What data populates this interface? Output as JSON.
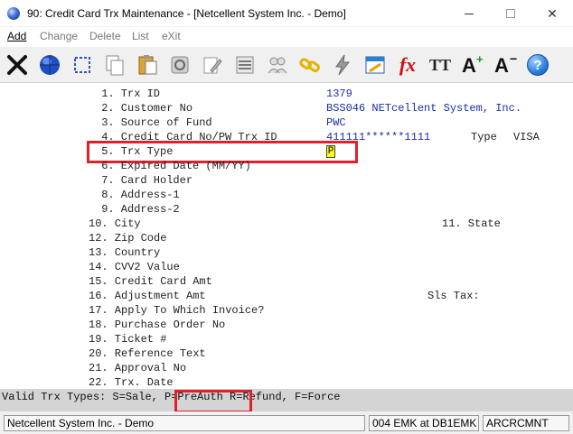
{
  "window": {
    "title": "90: Credit Card Trx Maintenance - [Netcellent System Inc. - Demo]",
    "controls": {
      "minimize": "—",
      "maximize": "☐",
      "close": "✕"
    }
  },
  "menu": [
    {
      "label": "Add",
      "active": true
    },
    {
      "label": "Change",
      "active": false
    },
    {
      "label": "Delete",
      "active": false
    },
    {
      "label": "List",
      "active": false
    },
    {
      "label": "eXit",
      "active": false
    }
  ],
  "toolbar": {
    "icons": [
      "close-x-icon",
      "globe-icon",
      "select-icon",
      "copy-icon",
      "paste-icon",
      "settings-icon",
      "edit-icon",
      "list-icon",
      "users-icon",
      "link-icon",
      "lightning-icon",
      "calendar-icon",
      "function-icon",
      "font-icon",
      "font-increase-icon",
      "font-decrease-icon",
      "help-icon"
    ],
    "fx_text": "fx",
    "tt_text": "TT",
    "a_plus": "A",
    "a_minus": "A",
    "help_text": "?"
  },
  "fields": [
    {
      "label": " 1. Trx ID",
      "value": "1379"
    },
    {
      "label": " 2. Customer No",
      "value": "BSS046 NETcellent System, Inc."
    },
    {
      "label": " 3. Source of Fund",
      "value": "PWC"
    },
    {
      "label": " 4. Credit Card No/PW Trx ID",
      "value": "411111******1111"
    },
    {
      "label": " 5. Trx Type",
      "value": ""
    },
    {
      "label": " 6. Expired Date (MM/YY)",
      "value": ""
    },
    {
      "label": " 7. Card Holder",
      "value": ""
    },
    {
      "label": " 8. Address-1",
      "value": ""
    },
    {
      "label": " 9. Address-2",
      "value": ""
    },
    {
      "label": "10. City",
      "value": ""
    },
    {
      "label": "12. Zip Code",
      "value": ""
    },
    {
      "label": "13. Country",
      "value": ""
    },
    {
      "label": "14. CVV2 Value",
      "value": ""
    },
    {
      "label": "15. Credit Card Amt",
      "value": ""
    },
    {
      "label": "16. Adjustment Amt",
      "value": ""
    },
    {
      "label": "17. Apply To Which Invoice?",
      "value": ""
    },
    {
      "label": "18. Purchase Order No",
      "value": ""
    },
    {
      "label": "19. Ticket #",
      "value": ""
    },
    {
      "label": "20. Reference Text",
      "value": ""
    },
    {
      "label": "21. Approval No",
      "value": ""
    },
    {
      "label": "22. Trx. Date",
      "value": ""
    }
  ],
  "extras": {
    "type_label": "Type",
    "type_value": "VISA",
    "state_label": "11. State",
    "sls_tax_label": "Sls Tax:",
    "trx_type_cursor": "P"
  },
  "helpline": {
    "prefix": "Valid Trx Types: S=Sale, ",
    "highlight": "P=PreAuth",
    "suffix": " R=Refund, F=Force"
  },
  "status": {
    "company": "Netcellent System Inc. - Demo",
    "session": "004 EMK at DB1EMK",
    "program": "ARCRCMNT"
  },
  "colors": {
    "value_text": "#1d2fa6",
    "highlight_border": "#e0202a",
    "cursor_bg": "#ffff00"
  }
}
